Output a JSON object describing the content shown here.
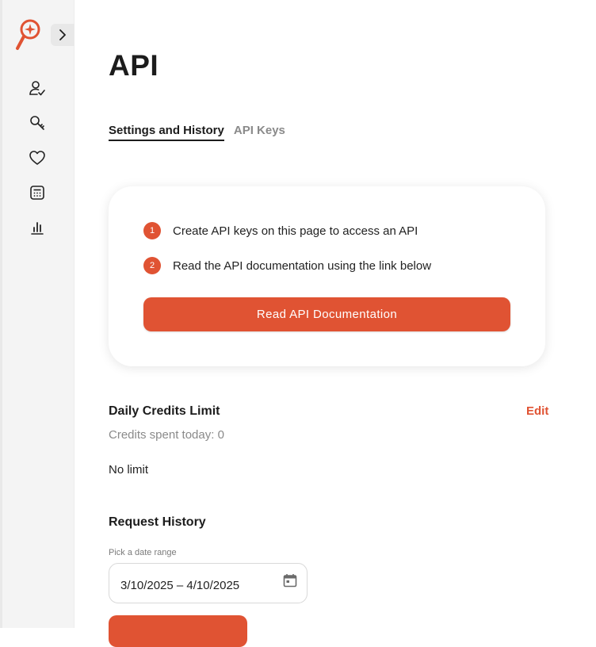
{
  "sidebar": {
    "logo_icon": "magnifier-sparkle-logo",
    "collapse_icon": "chevron-right-icon",
    "items": [
      {
        "icon": "user-check-icon"
      },
      {
        "icon": "key-icon"
      },
      {
        "icon": "heart-icon"
      },
      {
        "icon": "calculator-icon"
      },
      {
        "icon": "bar-chart-icon"
      }
    ]
  },
  "page": {
    "title": "API"
  },
  "tabs": [
    {
      "label": "Settings and History",
      "active": true
    },
    {
      "label": "API Keys",
      "active": false
    }
  ],
  "card": {
    "steps": [
      {
        "number": "1",
        "text": "Create API keys on this page to access an API"
      },
      {
        "number": "2",
        "text": "Read the API documentation using the link below"
      }
    ],
    "button_label": "Read API Documentation"
  },
  "credits": {
    "title": "Daily Credits Limit",
    "edit_label": "Edit",
    "spent_text": "Credits spent today: 0",
    "limit_text": "No limit"
  },
  "history": {
    "title": "Request History",
    "date_label": "Pick a date range",
    "date_value": "3/10/2025 – 4/10/2025",
    "date_icon": "calendar-icon"
  },
  "colors": {
    "accent": "#e05333",
    "sidebar_bg": "#f4f4f4",
    "muted_text": "#8a8a8a"
  }
}
